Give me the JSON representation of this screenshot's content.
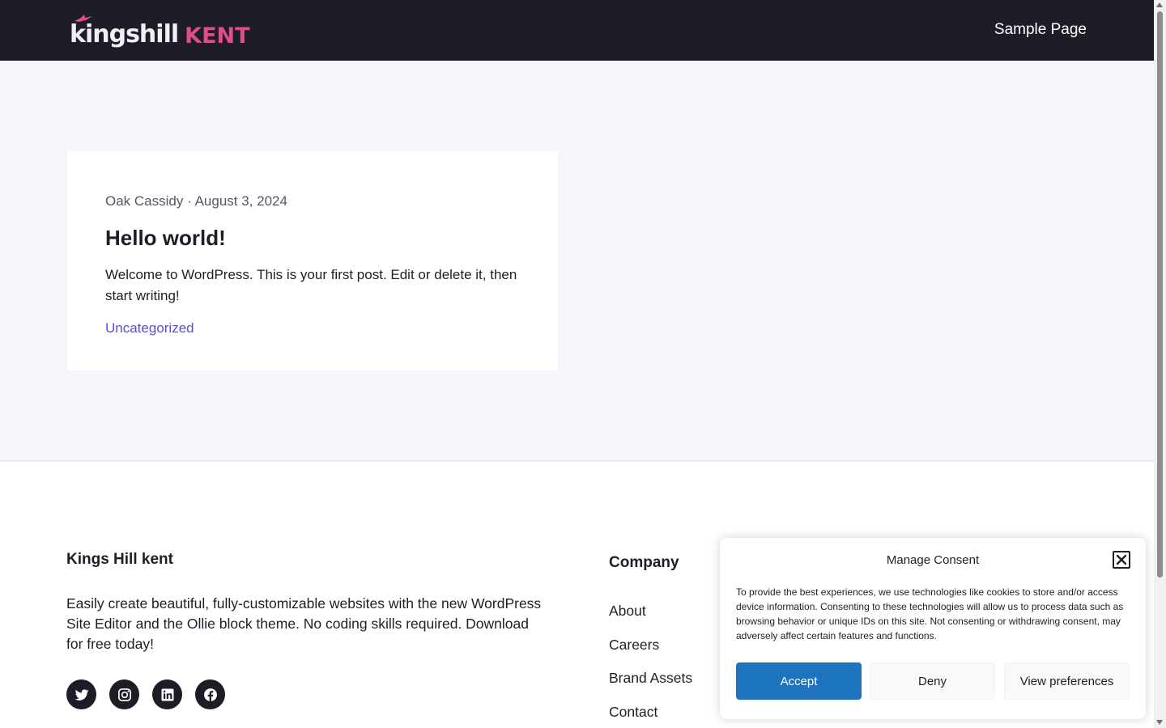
{
  "header": {
    "logo_word1": "kingshill",
    "logo_word2": "KENT",
    "nav": [
      "Sample Page"
    ]
  },
  "post": {
    "author": "Oak Cassidy",
    "separator": "·",
    "date": "August 3, 2024",
    "title": "Hello world!",
    "excerpt": "Welcome to WordPress. This is your first post. Edit or delete it, then start writing!",
    "category": "Uncategorized"
  },
  "footer": {
    "site_title": "Kings Hill kent",
    "description": "Easily create beautiful, fully-customizable websites with the new WordPress Site Editor and the Ollie block theme. No coding skills required. Download for free today!",
    "socials": [
      "twitter-icon",
      "instagram-icon",
      "linkedin-icon",
      "facebook-icon"
    ],
    "company_title": "Company",
    "company_links": [
      "About",
      "Careers",
      "Brand Assets",
      "Contact"
    ]
  },
  "consent": {
    "title": "Manage Consent",
    "text": "To provide the best experiences, we use technologies like cookies to store and/or access device information. Consenting to these technologies will allow us to process data such as browsing behavior or unique IDs on this site. Not consenting or withdrawing consent, may adversely affect certain features and functions.",
    "accept": "Accept",
    "deny": "Deny",
    "preferences": "View preferences"
  },
  "colors": {
    "header_bg": "#1d1d27",
    "logo_accent": "#e04d8c",
    "link": "#5a4fcf",
    "accept_button": "#1e73be"
  }
}
